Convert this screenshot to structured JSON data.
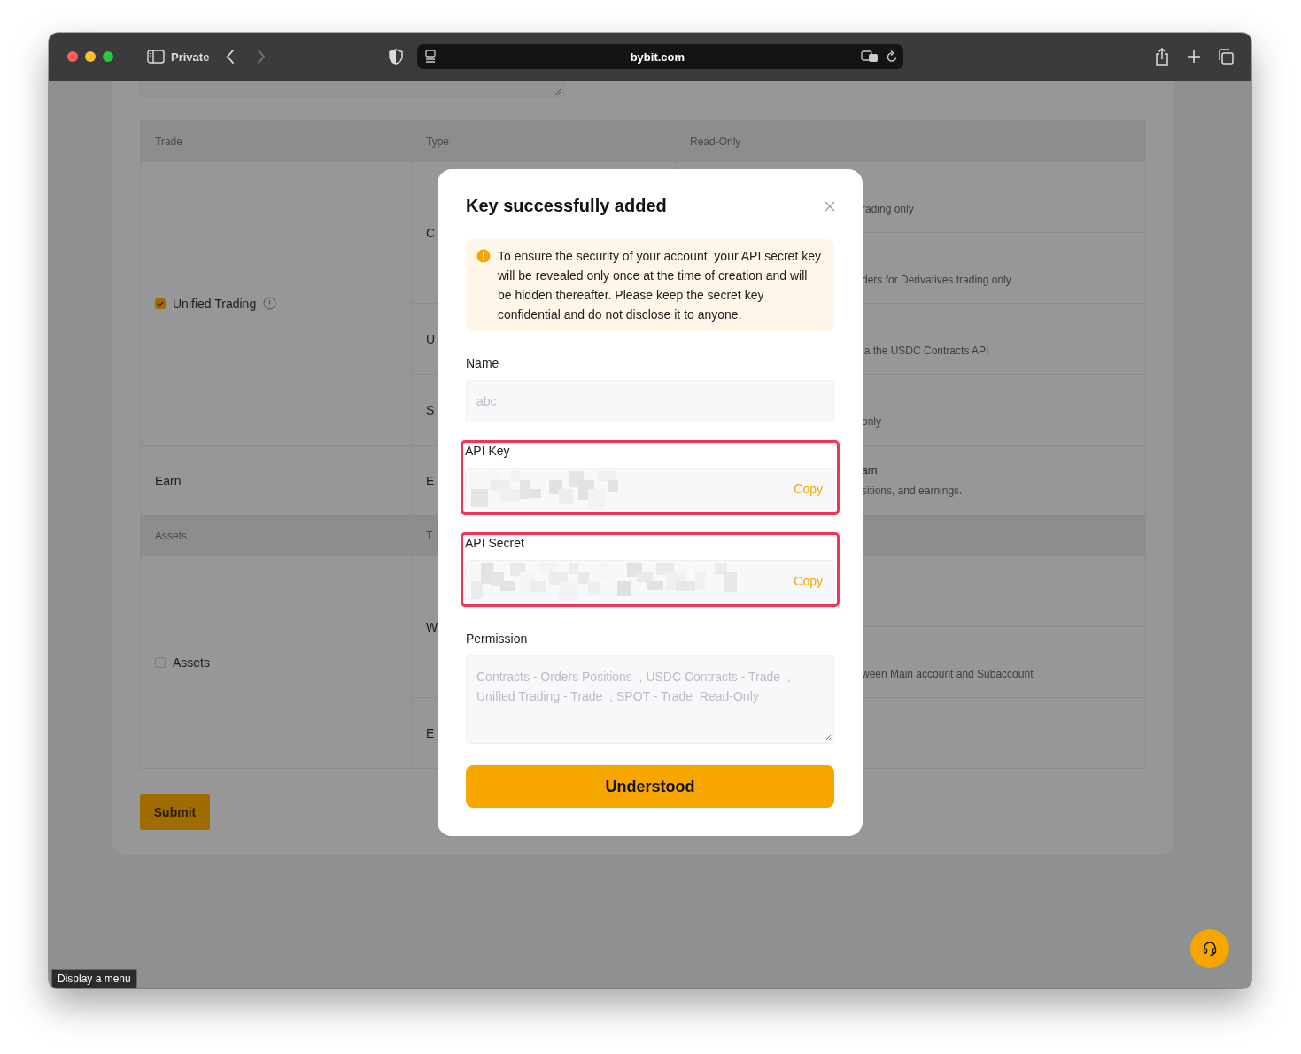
{
  "browser": {
    "mode_label": "Private",
    "url": "bybit.com"
  },
  "table": {
    "sections": [
      {
        "columns": [
          "Trade",
          "Type",
          "Read-Only"
        ],
        "groups": [
          {
            "label": "Unified Trading",
            "checked": true,
            "info": true,
            "types": [
              {
                "label": "C",
                "perms": [
                  {
                    "kind": "text",
                    "lines": [
                      "rading only"
                    ]
                  },
                  {
                    "kind": "text",
                    "lines": [
                      "ders for Derivatives trading only"
                    ]
                  }
                ]
              },
              {
                "label": "U",
                "perms": [
                  {
                    "kind": "text",
                    "lines": [
                      "ia the USDC Contracts API"
                    ]
                  }
                ]
              },
              {
                "label": "S",
                "perms": [
                  {
                    "kind": "text",
                    "lines": [
                      "only"
                    ]
                  }
                ]
              }
            ]
          },
          {
            "label": "Earn",
            "types": [
              {
                "label": "E",
                "perms": [
                  {
                    "kind": "text",
                    "lines": [
                      "arn",
                      "sitions, and earnings."
                    ]
                  }
                ]
              }
            ]
          }
        ]
      },
      {
        "columns": [
          "Assets",
          "T"
        ],
        "groups": [
          {
            "label": "Assets",
            "checked": false,
            "types": [
              {
                "label": "W",
                "perms": [
                  {
                    "kind": "blank"
                  },
                  {
                    "kind": "text",
                    "lines": [
                      "ween Main account and Subaccount"
                    ]
                  }
                ]
              },
              {
                "label": "E",
                "perms": [
                  {
                    "kind": "blank"
                  }
                ]
              }
            ]
          }
        ]
      }
    ]
  },
  "submit": "Submit",
  "modal": {
    "title": "Key successfully added",
    "alert": "To ensure the security of your account, your API secret key will be revealed only once at the time of creation and will be hidden thereafter. Please keep the secret key confidential and do not disclose it to anyone.",
    "fields": [
      {
        "kind": "input",
        "label": "Name",
        "placeholder": "abc"
      },
      {
        "kind": "secret",
        "label": "API Key",
        "action": "Copy",
        "highlighted": true
      },
      {
        "kind": "secret",
        "label": "API Secret",
        "action": "Copy",
        "highlighted": true
      },
      {
        "kind": "textarea",
        "label": "Permission",
        "value": "Contracts - Orders Positions  , USDC Contracts - Trade  , Unified Trading - Trade  , SPOT - Trade  Read-Only"
      }
    ],
    "button": "Understood"
  },
  "tooltip": "Display a menu"
}
